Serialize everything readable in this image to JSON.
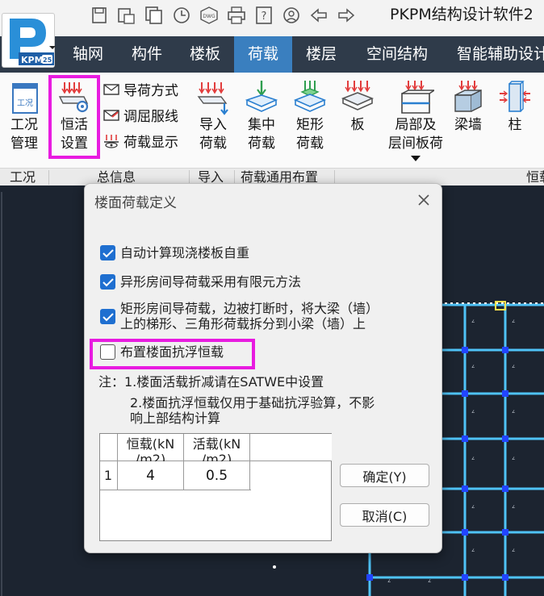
{
  "app": {
    "title": "PKPM结构设计软件2",
    "logo_text": "KPM",
    "logo_version": "25"
  },
  "quick_access": [
    {
      "icon": "save-icon"
    },
    {
      "icon": "save-as-icon"
    },
    {
      "icon": "save-all-icon"
    },
    {
      "icon": "history-icon"
    },
    {
      "icon": "dwg-icon",
      "label": "DWG"
    },
    {
      "icon": "print-icon"
    },
    {
      "icon": "help-icon",
      "label": "?"
    },
    {
      "icon": "user-icon"
    },
    {
      "icon": "undo-arrow-icon"
    },
    {
      "icon": "redo-arrow-icon"
    }
  ],
  "menu": [
    "轴网",
    "构件",
    "楼板",
    "荷载",
    "楼层",
    "空间结构",
    "智能辅助设计"
  ],
  "menu_active": "荷载",
  "ribbon": {
    "case_mgmt": {
      "line1": "工况",
      "line2": "管理",
      "icon_text": "工况"
    },
    "dead_live": {
      "line1": "恒活",
      "line2": "设置"
    },
    "small": [
      "导荷方式",
      "调屈服线",
      "荷载显示"
    ],
    "import": {
      "line1": "导入",
      "line2": "荷载"
    },
    "concentrated": {
      "line1": "集中",
      "line2": "荷载"
    },
    "rect": {
      "line1": "矩形",
      "line2": "荷载"
    },
    "slab": {
      "line1": "板"
    },
    "local": {
      "line1": "局部及",
      "line2": "层间板荷"
    },
    "beam_wall": {
      "line1": "梁墙"
    },
    "column": {
      "line1": "柱"
    }
  },
  "groups": [
    "工况",
    "总信息",
    "导入",
    "荷载通用布置",
    "恒载"
  ],
  "dialog": {
    "title": "楼面荷载定义",
    "options": [
      {
        "label": "自动计算现浇楼板自重",
        "checked": true
      },
      {
        "label": "异形房间导荷载采用有限元方法",
        "checked": true
      },
      {
        "label_line1": "矩形房间导荷载，边被打断时，将大梁（墙）",
        "label_line2": "上的梯形、三角形荷载拆分到小梁（墙）上",
        "checked": true
      },
      {
        "label": "布置楼面抗浮恒载",
        "checked": false
      }
    ],
    "note_line1": "注：1.楼面活载折减请在SATWE中设置",
    "note_line2": "2.楼面抗浮恒载仅用于基础抗浮验算，不影",
    "note_line3": "响上部结构计算",
    "table": {
      "headers": [
        "恒载(kN",
        "活载(kN"
      ],
      "header_units": "/m2)",
      "row_index": "1",
      "row": [
        "4",
        "0.5"
      ]
    },
    "ok_label": "确定(Y)",
    "cancel_label": "取消(C)"
  },
  "colors": {
    "menu_bg": "#2f3b4a",
    "menu_active": "#3a7fbf",
    "highlight": "#e81be0",
    "checkbox": "#1f6fd0",
    "canvas_bg": "#1c2430",
    "grid": "#4fc3f7"
  }
}
